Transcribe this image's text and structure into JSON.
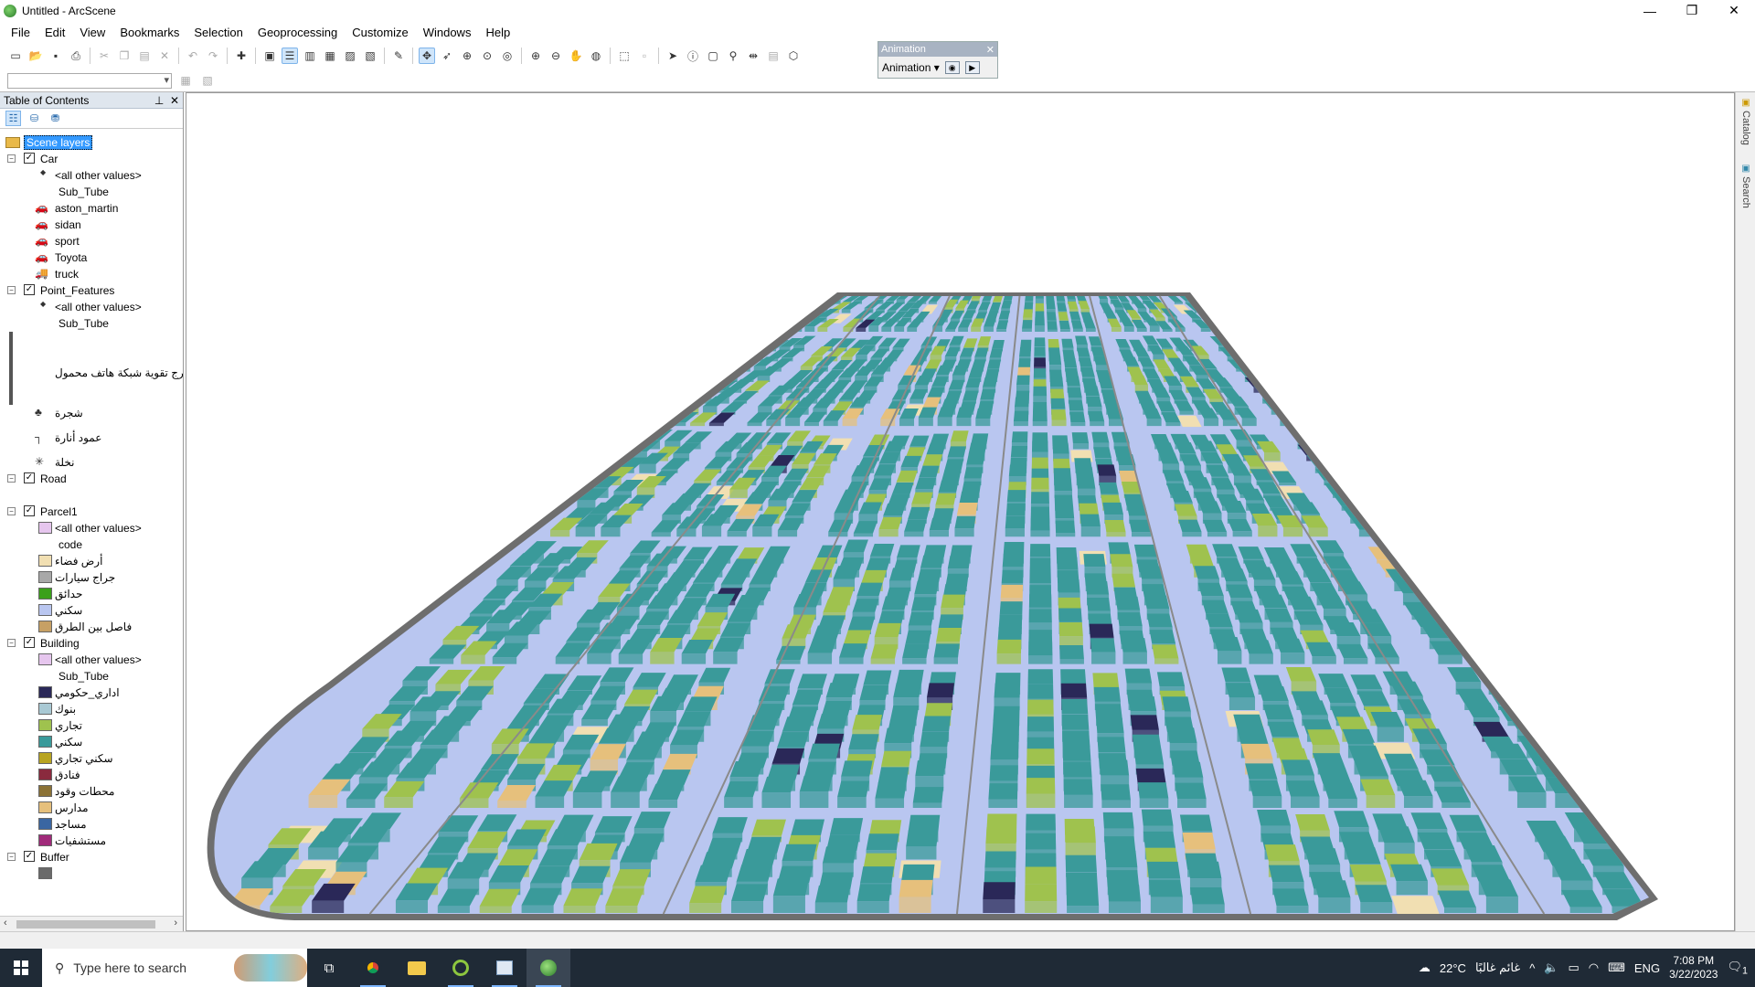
{
  "window": {
    "title": "Untitled - ArcScene",
    "controls": [
      "—",
      "❐",
      "✕"
    ]
  },
  "menu": [
    "File",
    "Edit",
    "View",
    "Bookmarks",
    "Selection",
    "Geoprocessing",
    "Customize",
    "Windows",
    "Help"
  ],
  "animation_toolbar": {
    "title": "Animation",
    "dropdown_label": "Animation"
  },
  "toc": {
    "title": "Table of Contents",
    "root": "Scene layers",
    "items": [
      {
        "kind": "layer",
        "label": "Car",
        "y": 0
      },
      {
        "kind": "symbol",
        "label": "<all other values>",
        "sym": "dot"
      },
      {
        "kind": "heading",
        "label": "Sub_Tube"
      },
      {
        "kind": "symbol",
        "label": "aston_martin",
        "sym": "car"
      },
      {
        "kind": "symbol",
        "label": "sidan",
        "sym": "car"
      },
      {
        "kind": "symbol",
        "label": "sport",
        "sym": "car"
      },
      {
        "kind": "symbol",
        "label": "Toyota",
        "sym": "car"
      },
      {
        "kind": "symbol",
        "label": "truck",
        "sym": "truck"
      },
      {
        "kind": "layer",
        "label": "Point_Features"
      },
      {
        "kind": "symbol",
        "label": "<all other values>",
        "sym": "dot"
      },
      {
        "kind": "heading",
        "label": "Sub_Tube"
      },
      {
        "kind": "tallsymbol",
        "label": "برج تقوية شبكة هاتف محمول"
      },
      {
        "kind": "symbol",
        "label": "شجرة",
        "sym": "tree"
      },
      {
        "kind": "symbol",
        "label": "عمود أنارة",
        "sym": "lamp"
      },
      {
        "kind": "symbol",
        "label": "نخلة",
        "sym": "palm"
      },
      {
        "kind": "layer",
        "label": "Road"
      },
      {
        "kind": "layer",
        "label": "Parcel1"
      },
      {
        "kind": "swatch",
        "label": "<all other values>",
        "color": "#e6c6ee"
      },
      {
        "kind": "heading",
        "label": "code"
      },
      {
        "kind": "swatch",
        "label": "أرض فضاء",
        "color": "#f1dfb2"
      },
      {
        "kind": "swatch",
        "label": "جراج سيارات",
        "color": "#a8a8a8"
      },
      {
        "kind": "swatch",
        "label": "حدائق",
        "color": "#3aa01a"
      },
      {
        "kind": "swatch",
        "label": "سكني",
        "color": "#b9c6f0"
      },
      {
        "kind": "swatch",
        "label": "فاصل بين الطرق",
        "color": "#c7a064"
      },
      {
        "kind": "layer",
        "label": "Building"
      },
      {
        "kind": "swatch",
        "label": "<all other values>",
        "color": "#e6c6ee"
      },
      {
        "kind": "heading",
        "label": "Sub_Tube"
      },
      {
        "kind": "swatch",
        "label": "اداري_حكومي",
        "color": "#2a2858"
      },
      {
        "kind": "swatch",
        "label": "بنوك",
        "color": "#a9c9d4"
      },
      {
        "kind": "swatch",
        "label": "تجاري",
        "color": "#9fc24e"
      },
      {
        "kind": "swatch",
        "label": "سكني",
        "color": "#3a9a9a"
      },
      {
        "kind": "swatch",
        "label": "سكني تجاري",
        "color": "#b8a420"
      },
      {
        "kind": "swatch",
        "label": "فنادق",
        "color": "#8a2a3e"
      },
      {
        "kind": "swatch",
        "label": "محطات وقود",
        "color": "#8b7236"
      },
      {
        "kind": "swatch",
        "label": "مدارس",
        "color": "#e6c07c"
      },
      {
        "kind": "swatch",
        "label": "مساجد",
        "color": "#3a66a2"
      },
      {
        "kind": "swatch",
        "label": "مستشفيات",
        "color": "#a02a7a"
      },
      {
        "kind": "layer",
        "label": "Buffer"
      },
      {
        "kind": "swatch",
        "label": "",
        "color": "#6a6a6a"
      }
    ]
  },
  "side_tabs": [
    "Catalog",
    "Search"
  ],
  "taskbar": {
    "search_placeholder": "Type here to search",
    "weather": "22°C",
    "weather_desc": "غائم غالبًا",
    "lang": "ENG",
    "time": "7:08 PM",
    "date": "3/22/2023",
    "notification_count": "1"
  },
  "colors": {
    "residential": "#3a9a9a",
    "commercial": "#9fc24e",
    "parcel_residential": "#b9c6f0",
    "vacant": "#f1dfb2",
    "road": "#8a8a8a"
  }
}
